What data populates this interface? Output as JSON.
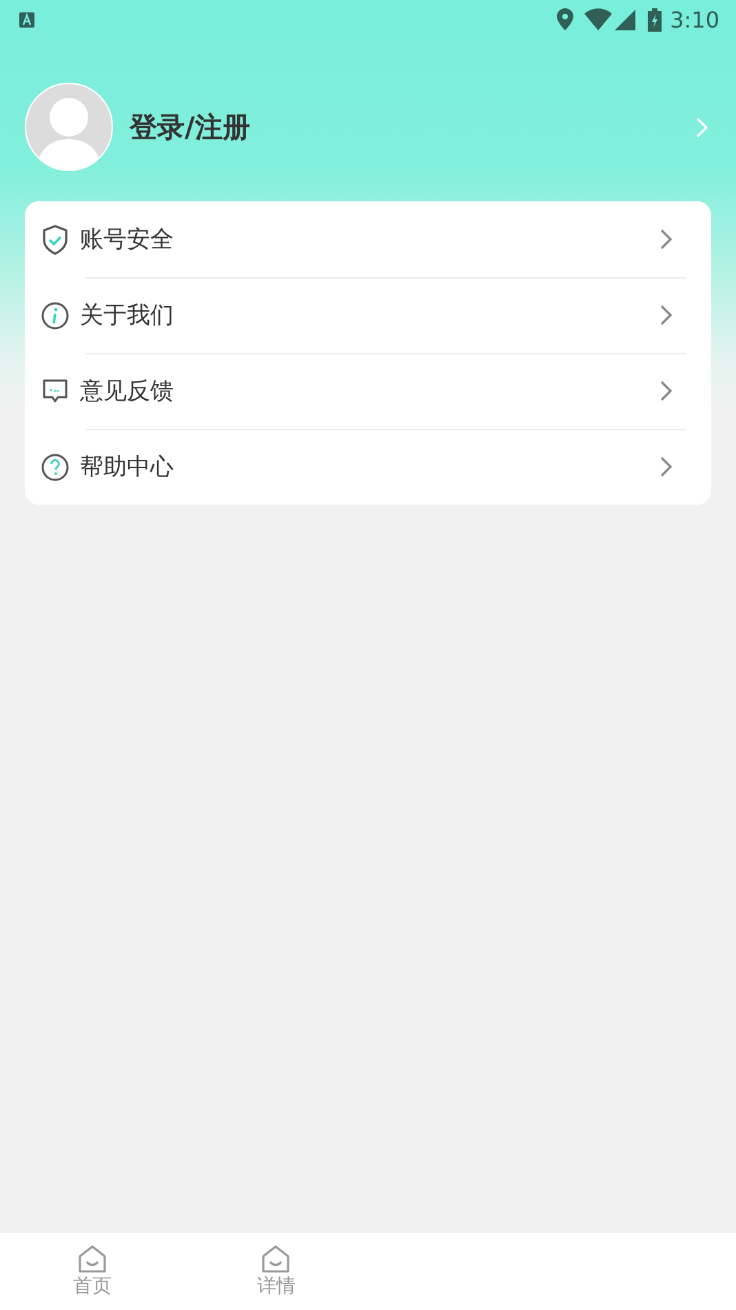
{
  "status_bar": {
    "time": "3:10"
  },
  "profile": {
    "name": "登录/注册"
  },
  "menu": [
    {
      "kind": "security",
      "label": "账号安全"
    },
    {
      "kind": "about",
      "label": "关于我们"
    },
    {
      "kind": "feedback",
      "label": "意见反馈"
    },
    {
      "kind": "help",
      "label": "帮助中心"
    }
  ],
  "tab_bar": [
    {
      "label": "首页"
    },
    {
      "label": "详情"
    }
  ]
}
